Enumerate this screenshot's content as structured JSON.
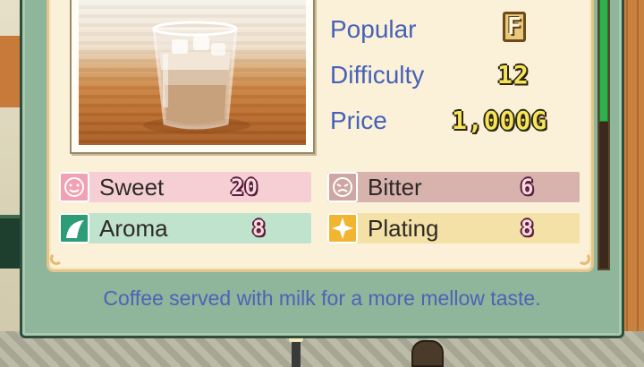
{
  "item": {
    "image_name": "iced-cafe-latte-glass",
    "stats": {
      "popular_label": "Popular",
      "popular_rank": "F",
      "difficulty_label": "Difficulty",
      "difficulty_value": "12",
      "price_label": "Price",
      "price_value": "1,000G"
    },
    "attributes": [
      {
        "label": "Sweet",
        "value": "20",
        "icon": "sweet-face-icon",
        "bar_color": "#f6cfd5",
        "icon_color": "#f2a1b2"
      },
      {
        "label": "Bitter",
        "value": "6",
        "icon": "bitter-face-icon",
        "bar_color": "#d8b2ad",
        "icon_color": "#cfa7a2"
      },
      {
        "label": "Aroma",
        "value": "8",
        "icon": "aroma-leaf-icon",
        "bar_color": "#bfe3cd",
        "icon_color": "#2f9c78"
      },
      {
        "label": "Plating",
        "value": "8",
        "icon": "plating-sparkle-icon",
        "bar_color": "#f4e1a8",
        "icon_color": "#f1b532"
      }
    ],
    "description": "Coffee served with milk for a more mellow taste."
  },
  "scrollbar": {
    "level": 0.47
  }
}
